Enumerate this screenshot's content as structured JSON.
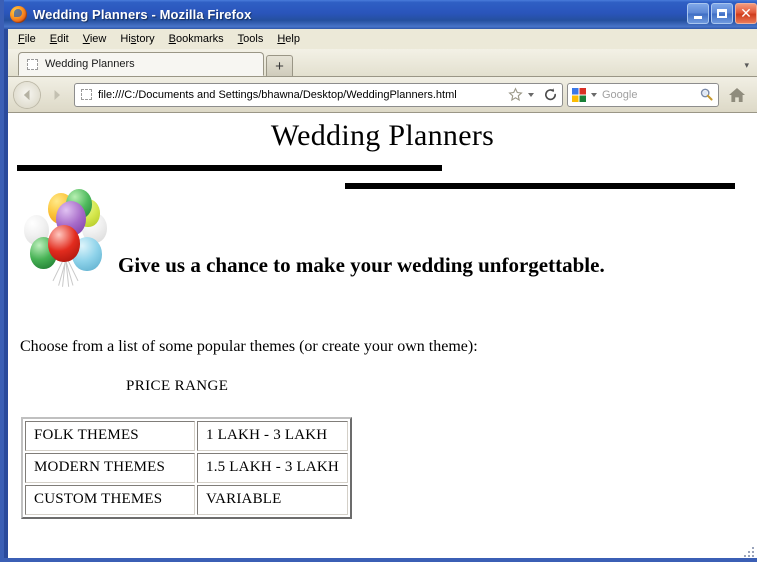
{
  "window": {
    "title": "Wedding Planners - Mozilla Firefox",
    "app_icon": "firefox-logo-icon",
    "minimize_label": "",
    "maximize_label": "",
    "close_label": "✕"
  },
  "menubar": {
    "items": [
      {
        "label": "File",
        "accesskey": "F"
      },
      {
        "label": "Edit",
        "accesskey": "E"
      },
      {
        "label": "View",
        "accesskey": "V"
      },
      {
        "label": "History",
        "accesskey": "s"
      },
      {
        "label": "Bookmarks",
        "accesskey": "B"
      },
      {
        "label": "Tools",
        "accesskey": "T"
      },
      {
        "label": "Help",
        "accesskey": "H"
      }
    ]
  },
  "tabstrip": {
    "tabs": [
      {
        "label": "Wedding Planners",
        "favicon": "blank-favicon",
        "active": true
      }
    ],
    "new_tab_label": "+",
    "list_all_tabs_label": "▾"
  },
  "navbar": {
    "back_label": "",
    "forward_label": "",
    "url": "file:///C:/Documents and Settings/bhawna/Desktop/WeddingPlanners.html",
    "url_favicon": "blank-favicon",
    "bookmark_icon": "star-icon",
    "reload_icon": "reload-icon",
    "search_engine": "Google",
    "search_placeholder": "Google",
    "search_icon": "magnifier-icon",
    "home_icon": "home-icon"
  },
  "page": {
    "heading": "Wedding Planners",
    "image_alt": "balloons-bunch",
    "tagline": "Give us a chance to make your wedding unforgettable.",
    "choose_text": "Choose from a list of some popular themes (or create your own theme):",
    "price_caption": "PRICE RANGE",
    "table": {
      "rows": [
        {
          "theme": "FOLK THEMES",
          "price": "1 LAKH - 3 LAKH"
        },
        {
          "theme": "MODERN THEMES",
          "price": "1.5 LAKH - 3 LAKH"
        },
        {
          "theme": "CUSTOM THEMES",
          "price": "VARIABLE"
        }
      ]
    }
  },
  "statusbar": {
    "resize_grip": "resize-grip"
  },
  "colors": {
    "titlebar_blue": "#2a55bb",
    "frame_blue": "#3b5fb5",
    "chrome_tan": "#ece9d8",
    "rule_black": "#000000",
    "page_bg": "#ffffff"
  }
}
